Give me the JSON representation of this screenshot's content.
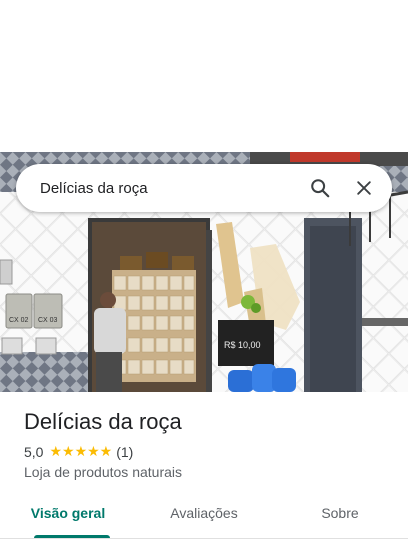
{
  "search": {
    "query": "Delícias da roça"
  },
  "icons": {
    "search": "search-icon",
    "close": "close-icon",
    "star": "star-icon"
  },
  "place": {
    "name": "Delícias da roça",
    "rating": "5,0",
    "rating_value": 5,
    "stars": "★★★★★",
    "review_count": "(1)",
    "category": "Loja de produtos naturais"
  },
  "photo": {
    "meter_label_1": "CX 02",
    "meter_label_2": "CX 03",
    "sign_text": "R$ 10,00"
  },
  "tabs": [
    {
      "label": "Visão geral",
      "active": true
    },
    {
      "label": "Avaliações",
      "active": false
    },
    {
      "label": "Sobre",
      "active": false
    }
  ],
  "colors": {
    "accent": "#00796b",
    "star": "#fbbc04"
  }
}
